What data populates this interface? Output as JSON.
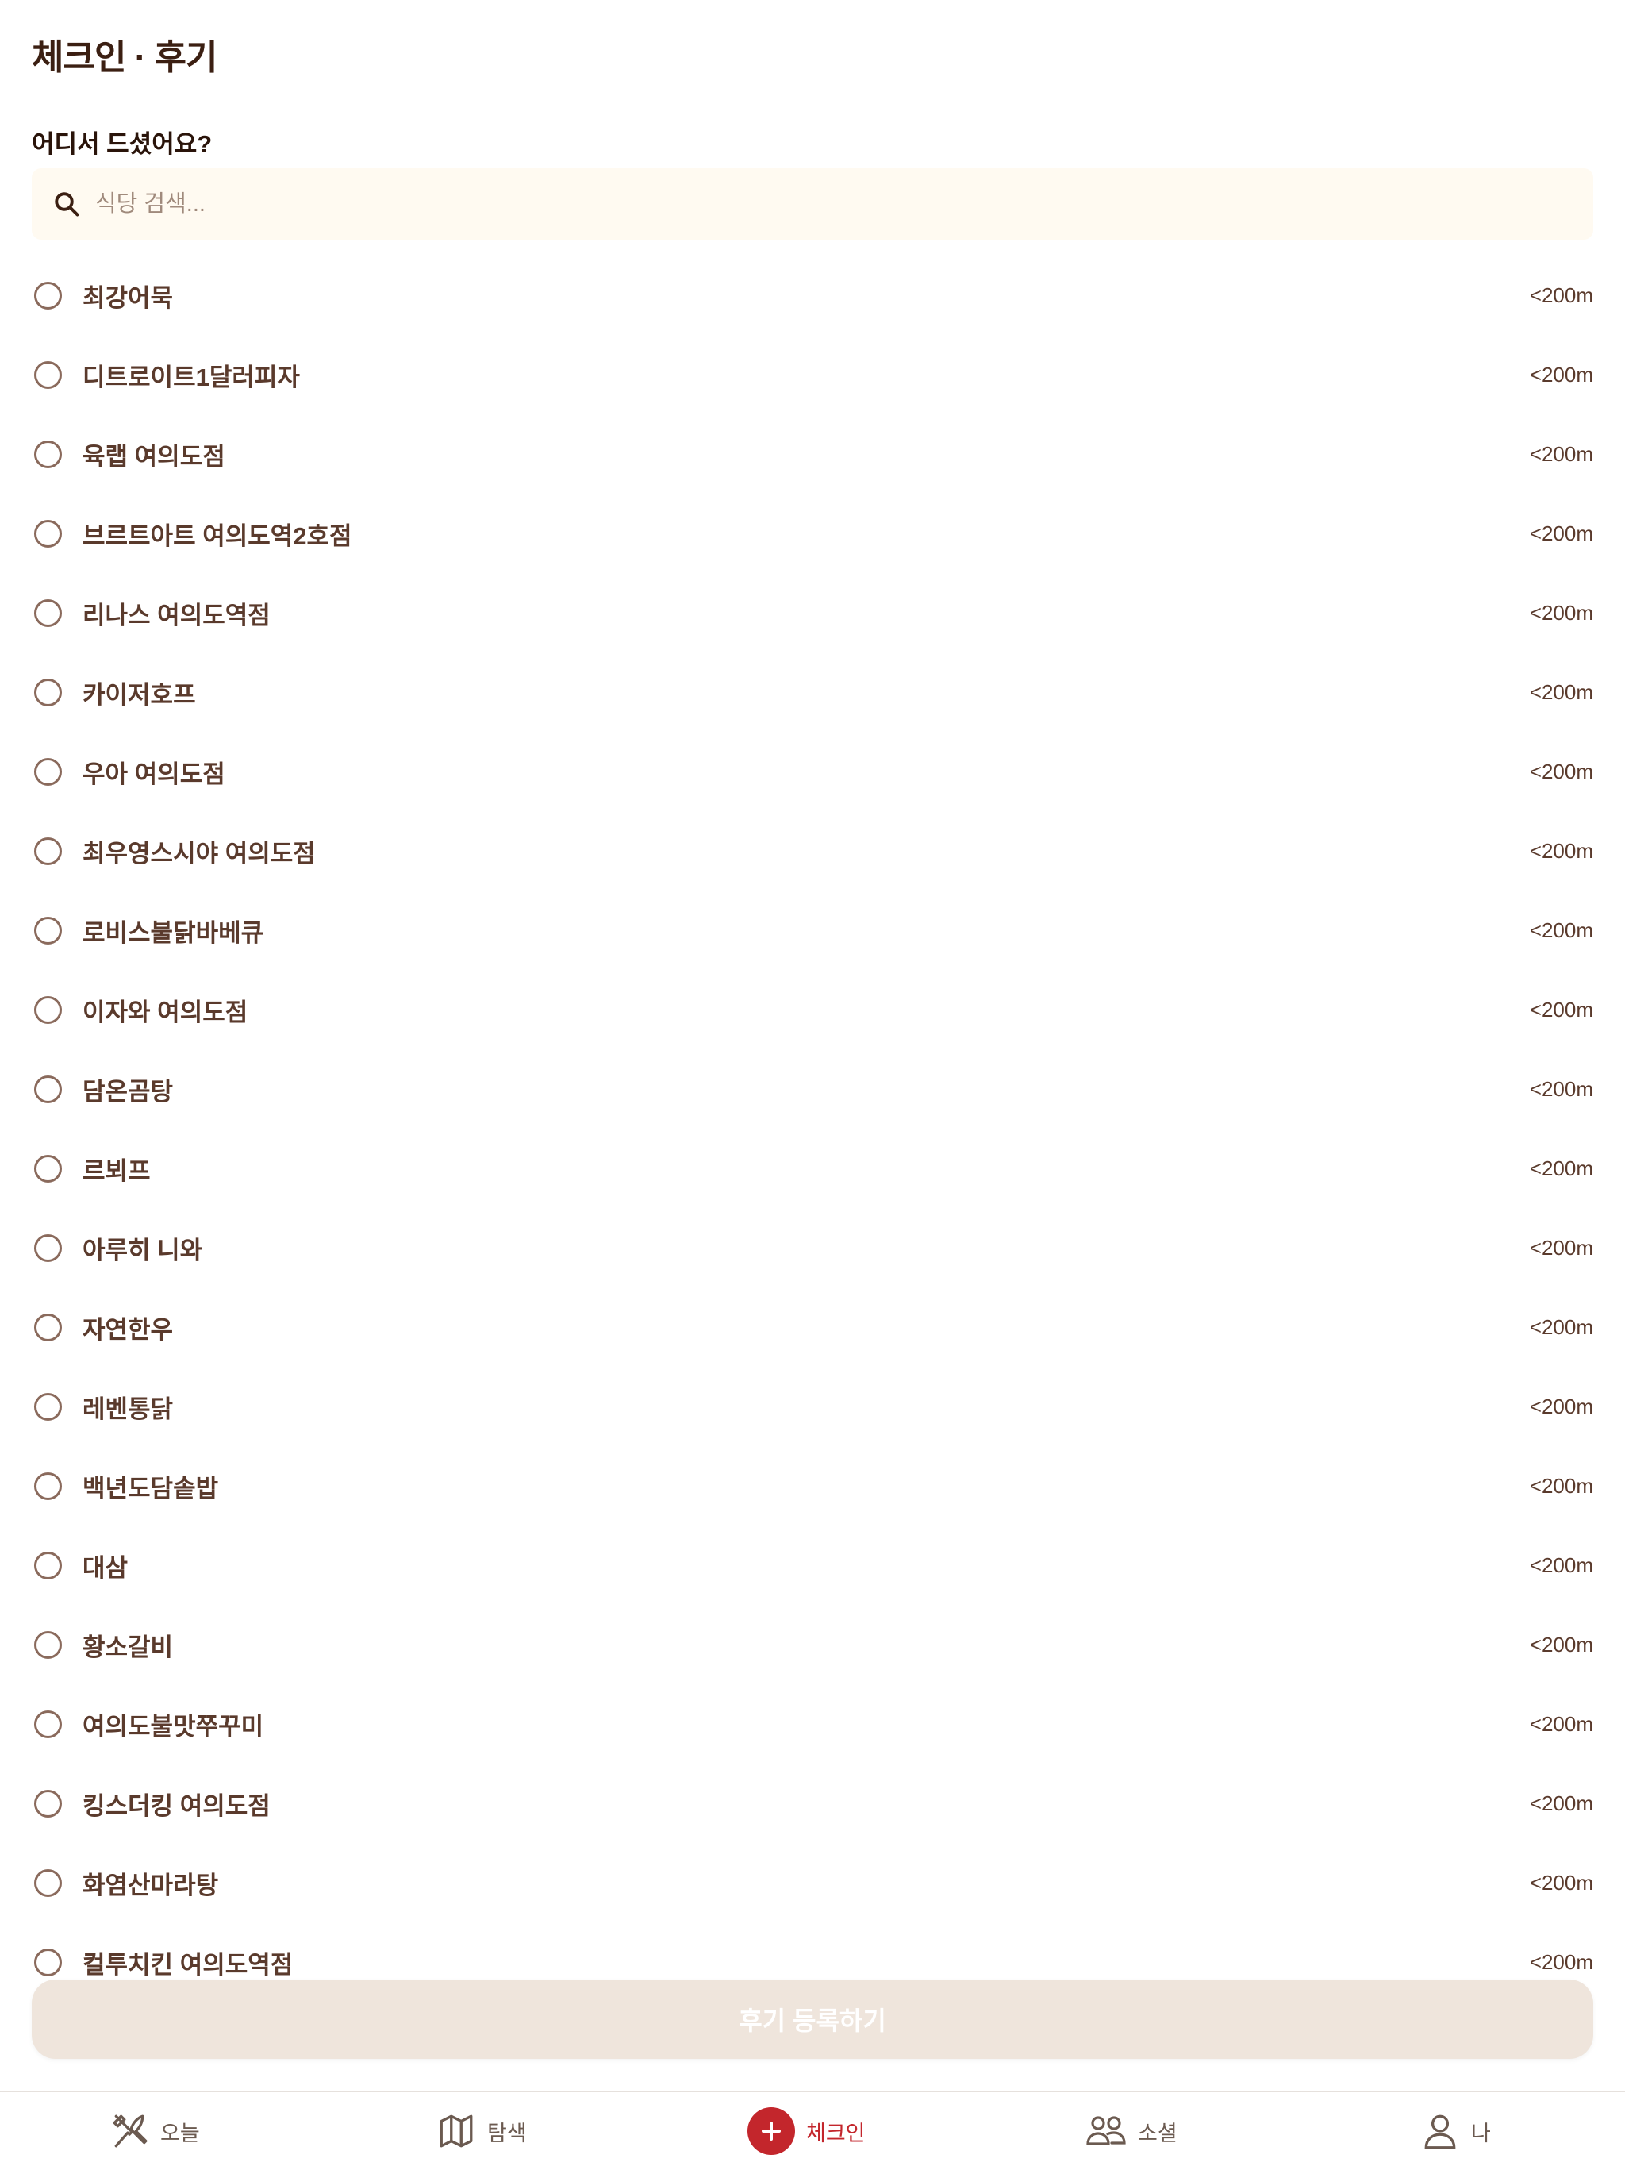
{
  "header": {
    "title": "체크인 · 후기"
  },
  "question": "어디서 드셨어요?",
  "search": {
    "placeholder": "식당 검색...",
    "value": ""
  },
  "restaurants": [
    {
      "name": "최강어묵",
      "distance": "<200m"
    },
    {
      "name": "디트로이트1달러피자",
      "distance": "<200m"
    },
    {
      "name": "육랩 여의도점",
      "distance": "<200m"
    },
    {
      "name": "브르트아트 여의도역2호점",
      "distance": "<200m"
    },
    {
      "name": "리나스 여의도역점",
      "distance": "<200m"
    },
    {
      "name": "카이저호프",
      "distance": "<200m"
    },
    {
      "name": "우아 여의도점",
      "distance": "<200m"
    },
    {
      "name": "최우영스시야 여의도점",
      "distance": "<200m"
    },
    {
      "name": "로비스불닭바베큐",
      "distance": "<200m"
    },
    {
      "name": "이자와 여의도점",
      "distance": "<200m"
    },
    {
      "name": "담온곰탕",
      "distance": "<200m"
    },
    {
      "name": "르뵈프",
      "distance": "<200m"
    },
    {
      "name": "아루히 니와",
      "distance": "<200m"
    },
    {
      "name": "자연한우",
      "distance": "<200m"
    },
    {
      "name": "레벤통닭",
      "distance": "<200m"
    },
    {
      "name": "백년도담솥밥",
      "distance": "<200m"
    },
    {
      "name": "대삼",
      "distance": "<200m"
    },
    {
      "name": "황소갈비",
      "distance": "<200m"
    },
    {
      "name": "여의도불맛쭈꾸미",
      "distance": "<200m"
    },
    {
      "name": "킹스더킹 여의도점",
      "distance": "<200m"
    },
    {
      "name": "화염산마라탕",
      "distance": "<200m"
    },
    {
      "name": "컬투치킨 여의도역점",
      "distance": "<200m"
    }
  ],
  "submit": {
    "label": "후기 등록하기"
  },
  "tabs": [
    {
      "label": "오늘",
      "icon": "utensils-icon"
    },
    {
      "label": "탐색",
      "icon": "map-icon"
    },
    {
      "label": "체크인",
      "icon": "plus-icon"
    },
    {
      "label": "소셜",
      "icon": "people-icon"
    },
    {
      "label": "나",
      "icon": "user-icon"
    }
  ],
  "colors": {
    "accent": "#c3262c",
    "text_brown": "#5a3a2c",
    "search_bg": "#fffaf1",
    "button_disabled": "#efe5dc"
  }
}
